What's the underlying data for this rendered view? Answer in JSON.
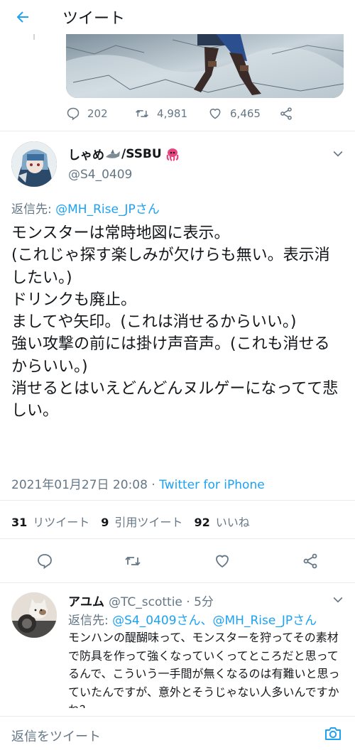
{
  "header": {
    "title": "ツイート"
  },
  "previous_tweet": {
    "reply_count": "202",
    "retweet_count": "4,981",
    "like_count": "6,465"
  },
  "tweet": {
    "display_name": "しゃめ",
    "display_name_suffix": "/SSBU",
    "handle": "@S4_0409",
    "replying_label": "返信先: ",
    "replying_to": "@MH_Rise_JPさん",
    "text": "モンスターは常時地図に表示。\n(これじゃ探す楽しみが欠けらも無い。表示消したい。)\nドリンクも廃止。\nましてや矢印。(これは消せるからいい。)\n強い攻撃の前には掛け声音声。(これも消せるからいい。)\n消せるとはいえどんどんヌルゲーになってて悲しい。",
    "timestamp": "2021年01月27日 20:08 · ",
    "source": "Twitter for iPhone",
    "retweets": "31",
    "retweets_label": "リツイート",
    "quotes": "9",
    "quotes_label": "引用ツイート",
    "likes": "92",
    "likes_label": "いいね"
  },
  "reply": {
    "name": "アユム",
    "handle_time": "@TC_scottie · 5分",
    "replying_label": "返信先: ",
    "replying_to": "@S4_0409さん、@MH_Rise_JPさん",
    "text": "モンハンの醍醐味って、モンスターを狩ってその素材で防具を作って強くなっていくってところだと思ってるんで、こういう一手間が無くなるのは有難いと思っていたんですが、意外とそうじゃない人多いんですかね？"
  },
  "composer": {
    "placeholder": "返信をツイート"
  },
  "colors": {
    "accent": "#1da1f2",
    "secondary_text": "#657786",
    "divider": "#e6ecf0",
    "emoji_pink": "#e8457e"
  },
  "icons": [
    "back-arrow-icon",
    "reply-icon",
    "retweet-icon",
    "like-icon",
    "share-icon",
    "chevron-down-icon",
    "shark-emoji-icon",
    "octopus-emoji-icon",
    "camera-icon"
  ]
}
